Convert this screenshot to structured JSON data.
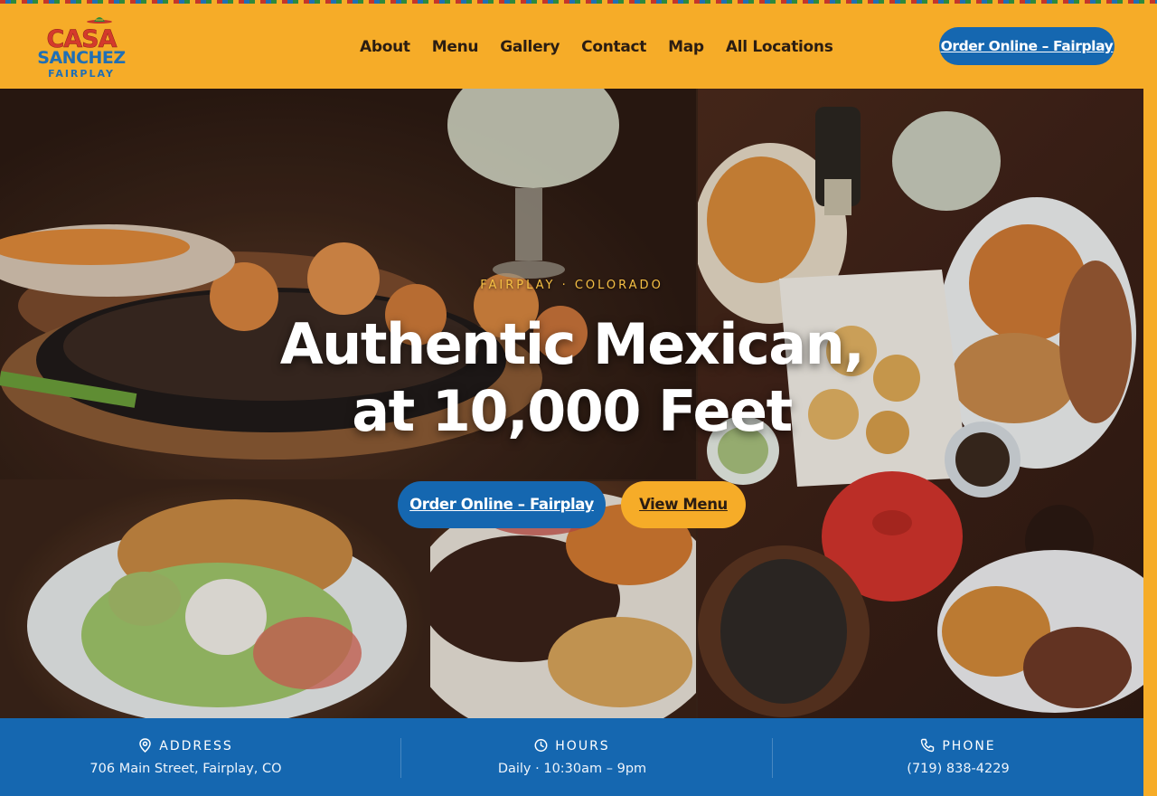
{
  "brand": {
    "line1": "CASA",
    "line2": "SANCHEZ",
    "line3": "FAIRPLAY"
  },
  "nav": {
    "items": [
      "About",
      "Menu",
      "Gallery",
      "Contact",
      "Map",
      "All Locations"
    ]
  },
  "header": {
    "order_button": "Order Online – Fairplay"
  },
  "hero": {
    "eyebrow": "FAIRPLAY · COLORADO",
    "headline_line1": "Authentic Mexican,",
    "headline_line2": "at 10,000 Feet",
    "order_button": "Order Online – Fairplay",
    "menu_button": "View Menu"
  },
  "info": {
    "address_label": "ADDRESS",
    "address_value": "706 Main Street, Fairplay, CO",
    "hours_label": "HOURS",
    "hours_value": "Daily · 10:30am – 9pm",
    "phone_label": "PHONE",
    "phone_value": "(719) 838-4229"
  },
  "colors": {
    "brand_orange": "#f6ac28",
    "brand_blue": "#1567b0",
    "brand_red": "#d43a2c",
    "text_dark": "#2b1d12"
  }
}
